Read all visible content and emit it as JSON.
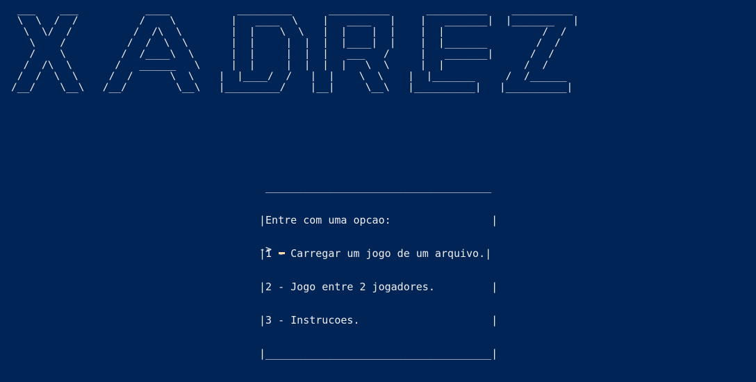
{
  "banner": {
    "ascii_art": " ___    ___           ____           _________      __________      __________    __________\n \\  \\  /  /          /    \\         |   ____  \\    |   ____   |    |   _______|  |_______   |\n  \\  \\/  /          /  /\\  \\        |  |    \\  \\   |  |    |  |    |  |                /  /\n   \\    /          /  /  \\  \\       |  |     |  |  |  |____|  |    |  |_______        /  /\n   /    \\         /  /____\\  \\      |  |     |  |  |   ___   /     |   _______|      /  /\n  /  /\\  \\       /   ______   \\     |  |     |  |  |  |   \\  \\     |  |             /  /\n /  /  \\  \\     /  /      \\  \\    |  |____/  /   |  |    \\  \\    |  |_______     /  /______\n/__/    \\__\\   /__/        \\__\\   |_________/    |__|     \\__\\   |__________|   |__________|"
  },
  "menu": {
    "lines": [
      " ____________________________________",
      "|Entre com uma opcao:                |",
      "|1 - Carregar um jogo de um arquivo.|",
      "|2 - Jogo entre 2 jogadores.         |",
      "|3 - Instrucoes.                     |",
      "|____________________________________|"
    ]
  },
  "prompt": {
    "text": "->"
  },
  "colors": {
    "background": "#012456",
    "foreground": "#eeedf0",
    "cursor": "#fedba9"
  }
}
